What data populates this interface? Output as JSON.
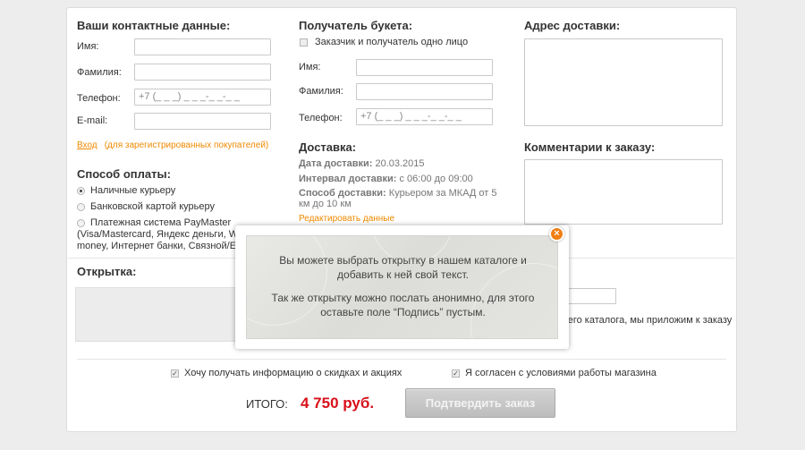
{
  "contacts": {
    "title": "Ваши контактные данные:",
    "name_label": "Имя:",
    "surname_label": "Фамилия:",
    "phone_label": "Телефон:",
    "phone_value": "+7 (_ _ _) _ _ _-_ _-_ _",
    "email_label": "E-mail:",
    "login_link": "Вход",
    "login_note": "(для зарегистрированных покупателей)"
  },
  "payment": {
    "title": "Способ оплаты:",
    "options": [
      "Наличные курьеру",
      "Банковской картой курьеру",
      "Платежная система PayMaster"
    ],
    "paymaster_line1": "(Visa/Mastercard, Яндекс деньги, We",
    "paymaster_line2": "money, Интернет банки, Связной/Евр"
  },
  "recipient": {
    "title": "Получатель букета:",
    "same_person": "Заказчик и получатель одно лицо",
    "name_label": "Имя:",
    "surname_label": "Фамилия:",
    "phone_label": "Телефон:",
    "phone_value": "+7 (_ _ _) _ _ _-_ _-_ _"
  },
  "delivery": {
    "title": "Доставка:",
    "date_label": "Дата доставки:",
    "date_value": "20.03.2015",
    "interval_label": "Интервал доставки:",
    "interval_value": "с 06:00 до 09:00",
    "method_label": "Способ доставки:",
    "method_value_1": "Курьером за МКАД от 5",
    "method_value_2": "км до 10 км",
    "edit_link": "Редактировать данные"
  },
  "address": {
    "title": "Адрес доставки:"
  },
  "comments": {
    "title": "Комментарии к заказу:"
  },
  "postcard": {
    "title": "Открытка:",
    "right_text": "вего каталога, мы приложим к заказу"
  },
  "popup": {
    "text1": "Вы можете выбрать открытку в нашем каталоге и добавить к ней свой текст.",
    "text2": "Так же открытку можно послать анонимно, для этого оставьте поле “Подпись” пустым.",
    "close_glyph": "×"
  },
  "footer": {
    "subscribe": "Хочу получать информацию о скидках и акциях",
    "agree": "Я согласен с условиями работы магазина",
    "check_glyph": "✓",
    "total_label": "ИТОГО:",
    "total_value": "4 750 руб.",
    "confirm": "Подтвердить заказ"
  },
  "colors": {
    "accent": "#f08a00",
    "total": "#d8101a",
    "button": "#c8c8c8"
  }
}
